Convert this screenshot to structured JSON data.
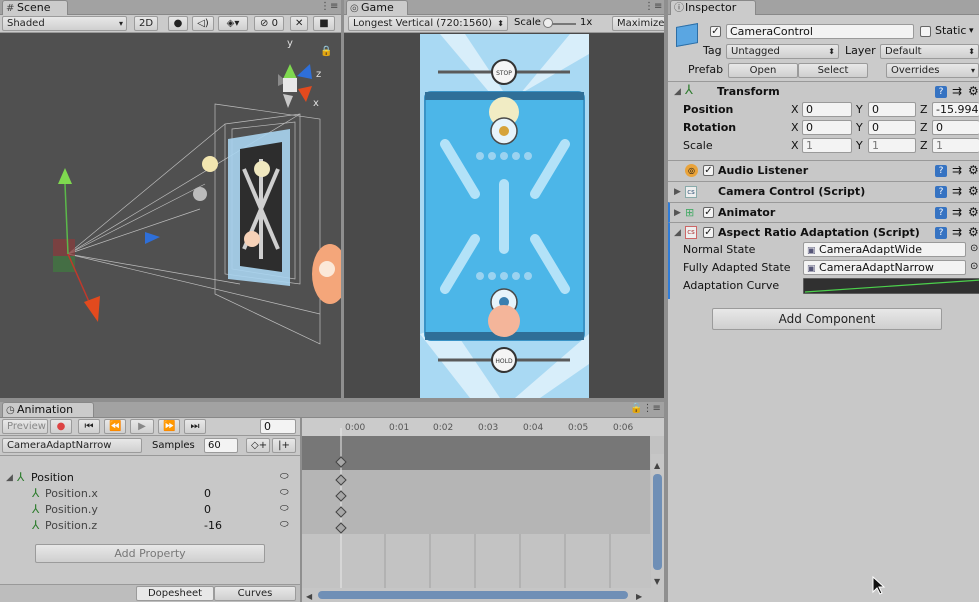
{
  "scene": {
    "tab": "Scene",
    "shading_mode": "Shaded",
    "mode_2d": "2D",
    "gizmo_count": "0",
    "axis_labels": {
      "y": "y",
      "z": "z",
      "x": "x"
    }
  },
  "game": {
    "tab": "Game",
    "resolution": "Longest Vertical (720:1560)",
    "scale_label": "Scale",
    "scale_value": "1x",
    "maximize_label": "Maximize C",
    "top_button": "STOP",
    "bottom_button": "HOLD"
  },
  "inspector": {
    "tab": "Inspector",
    "object_name": "CameraControl",
    "static_label": "Static",
    "tag_label": "Tag",
    "tag_value": "Untagged",
    "layer_label": "Layer",
    "layer_value": "Default",
    "prefab_label": "Prefab",
    "prefab_open": "Open",
    "prefab_select": "Select",
    "prefab_overrides": "Overrides",
    "transform": {
      "title": "Transform",
      "position_label": "Position",
      "rotation_label": "Rotation",
      "scale_label": "Scale",
      "x": "X",
      "y": "Y",
      "z": "Z",
      "position": [
        "0",
        "0",
        "-15.994"
      ],
      "rotation": [
        "0",
        "0",
        "0"
      ],
      "scale": [
        "1",
        "1",
        "1"
      ]
    },
    "components": [
      {
        "name": "Audio Listener",
        "checked": true
      },
      {
        "name": "Camera Control (Script)",
        "checked": false
      },
      {
        "name": "Animator",
        "checked": true
      },
      {
        "name": "Aspect Ratio Adaptation (Script)",
        "checked": true
      }
    ],
    "aspect": {
      "normal_state_label": "Normal State",
      "normal_state_value": "CameraAdaptWide",
      "fully_adapted_label": "Fully Adapted State",
      "fully_adapted_value": "CameraAdaptNarrow",
      "curve_label": "Adaptation Curve"
    },
    "add_component": "Add Component"
  },
  "animation": {
    "tab": "Animation",
    "preview": "Preview",
    "frame": "0",
    "clip": "CameraAdaptNarrow",
    "samples_label": "Samples",
    "samples_value": "60",
    "ruler": [
      "0:00",
      "0:01",
      "0:02",
      "0:03",
      "0:04",
      "0:05",
      "0:06"
    ],
    "group": "Position",
    "properties": [
      {
        "name": "Position.x",
        "value": "0"
      },
      {
        "name": "Position.y",
        "value": "0"
      },
      {
        "name": "Position.z",
        "value": "-16"
      }
    ],
    "add_property": "Add Property",
    "dopesheet": "Dopesheet",
    "curves": "Curves"
  },
  "colors": {
    "panel": "#cbcbcb",
    "scene_bg": "#505050",
    "game_sky": "#4fb6e6",
    "accent_blue": "#2f7cd8"
  }
}
